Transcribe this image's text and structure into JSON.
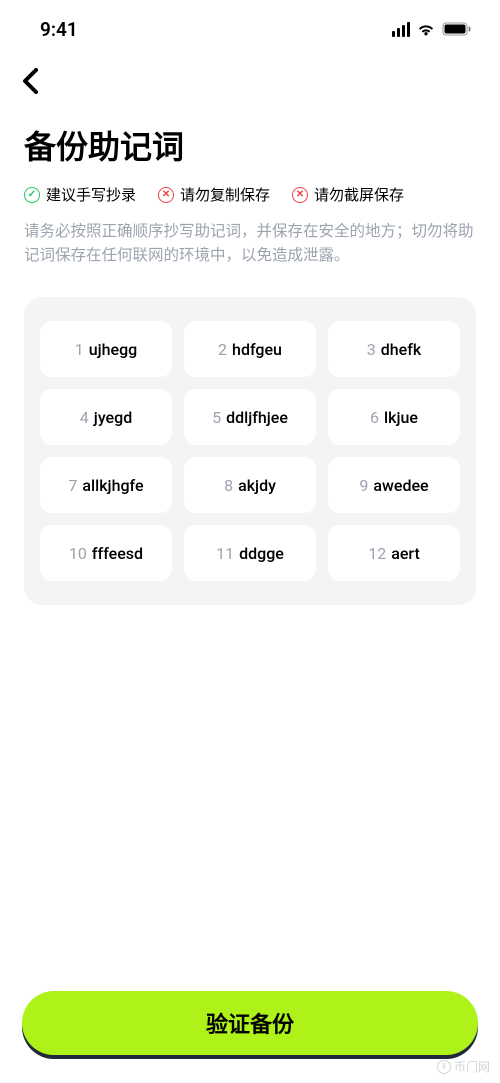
{
  "status": {
    "time": "9:41"
  },
  "header": {
    "title": "备份助记词"
  },
  "tips": [
    {
      "type": "green",
      "mark": "✓",
      "text": "建议手写抄录"
    },
    {
      "type": "red",
      "mark": "✕",
      "text": "请勿复制保存"
    },
    {
      "type": "red",
      "mark": "✕",
      "text": "请勿截屏保存"
    }
  ],
  "description": "请务必按照正确顺序抄写助记词，并保存在安全的地方；切勿将助记词保存在任何联网的环境中，以免造成泄露。",
  "mnemonic": [
    {
      "index": "1",
      "word": "ujhegg"
    },
    {
      "index": "2",
      "word": "hdfgeu"
    },
    {
      "index": "3",
      "word": "dhefk"
    },
    {
      "index": "4",
      "word": "jyegd"
    },
    {
      "index": "5",
      "word": "ddljfhjee"
    },
    {
      "index": "6",
      "word": "lkjue"
    },
    {
      "index": "7",
      "word": "allkjhgfe"
    },
    {
      "index": "8",
      "word": "akjdy"
    },
    {
      "index": "9",
      "word": "awedee"
    },
    {
      "index": "10",
      "word": "fffeesd"
    },
    {
      "index": "11",
      "word": "ddgge"
    },
    {
      "index": "12",
      "word": "aert"
    }
  ],
  "actions": {
    "verify_label": "验证备份"
  },
  "watermark": {
    "symbol": "¥",
    "text": "币门网"
  }
}
